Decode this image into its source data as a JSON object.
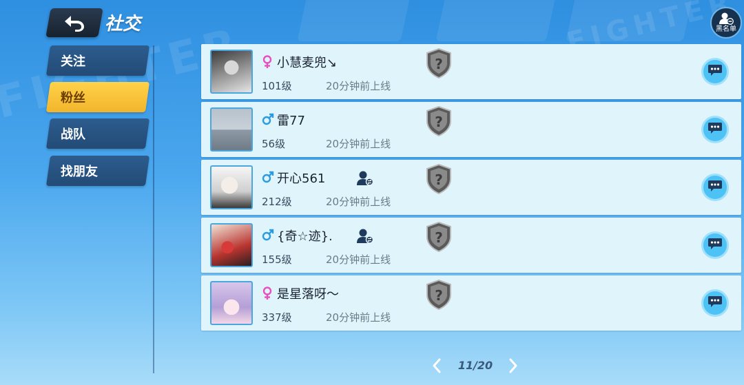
{
  "header": {
    "title": "社交",
    "back_icon": "back-arrow-icon",
    "blacklist_label": "黑名单"
  },
  "nav": {
    "items": [
      {
        "label": "关注",
        "active": false
      },
      {
        "label": "粉丝",
        "active": true
      },
      {
        "label": "战队",
        "active": false
      },
      {
        "label": "找朋友",
        "active": false
      }
    ]
  },
  "fans": [
    {
      "name": "小慧麦兜↘",
      "gender": "female",
      "level": "101级",
      "last_online": "20分钟前上线",
      "is_friend": false
    },
    {
      "name": "雷77",
      "gender": "male",
      "level": "56级",
      "last_online": "20分钟前上线",
      "is_friend": false
    },
    {
      "name": "开心561",
      "gender": "male",
      "level": "212级",
      "last_online": "20分钟前上线",
      "is_friend": true
    },
    {
      "name": "{奇☆迹}.",
      "gender": "male",
      "level": "155级",
      "last_online": "20分钟前上线",
      "is_friend": true
    },
    {
      "name": "是星落呀～",
      "gender": "female",
      "level": "337级",
      "last_online": "20分钟前上线",
      "is_friend": false
    }
  ],
  "pagination": {
    "text": "11/20"
  },
  "colors": {
    "accent_yellow": "#f2b52b",
    "nav_blue": "#234b76",
    "row_bg": "#dff5fb",
    "female": "#e84fc0",
    "male": "#2a9be0",
    "chat": "#4fc2f5"
  }
}
